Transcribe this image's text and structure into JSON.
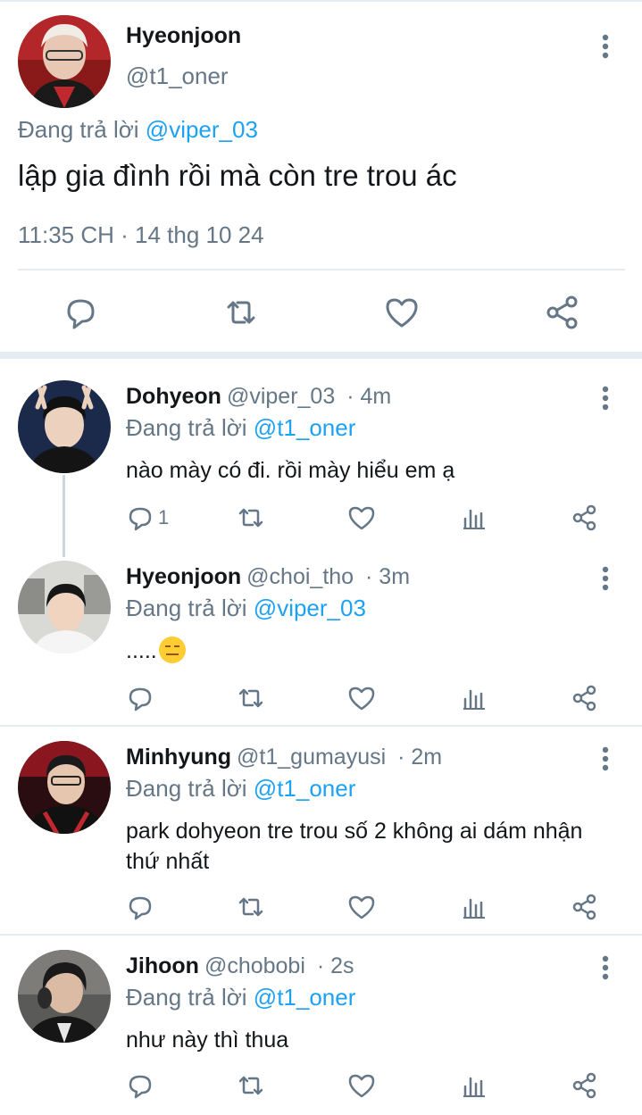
{
  "main_tweet": {
    "name": "Hyeonjoon",
    "handle": "@t1_oner",
    "replying_prefix": "Đang trả lời",
    "replying_to": "@viper_03",
    "text": "lập gia đình rồi mà còn tre trou ác",
    "timestamp": "11:35 CH · 14 thg 10 24"
  },
  "replies": [
    {
      "name": "Dohyeon",
      "handle": "@viper_03",
      "time": "· 4m",
      "replying_prefix": "Đang trả lời",
      "replying_to": "@t1_oner",
      "text": "nào mày có đi. rồi mày hiểu em ạ",
      "reply_count": "1"
    },
    {
      "name": "Hyeonjoon",
      "handle": "@choi_tho",
      "time": "· 3m",
      "replying_prefix": "Đang trả lời",
      "replying_to": "@viper_03",
      "text": ".....",
      "emoji": "expressionless-face"
    },
    {
      "name": "Minhyung",
      "handle": "@t1_gumayusi",
      "time": "· 2m",
      "replying_prefix": "Đang trả lời",
      "replying_to": "@t1_oner",
      "text": "park dohyeon tre trou số 2 không ai dám nhận thứ nhất"
    },
    {
      "name": "Jihoon",
      "handle": "@chobobi",
      "time": "· 2s",
      "replying_prefix": "Đang trả lời",
      "replying_to": "@t1_oner",
      "text": "như này thì thua"
    }
  ],
  "icons": {
    "reply": "reply-icon",
    "retweet": "retweet-icon",
    "like": "heart-icon",
    "analytics": "analytics-icon",
    "share": "share-icon",
    "more": "more-vertical-icon"
  },
  "colors": {
    "accent": "#1da1f2",
    "secondary_text": "#657786",
    "divider": "#e6ecf0"
  }
}
